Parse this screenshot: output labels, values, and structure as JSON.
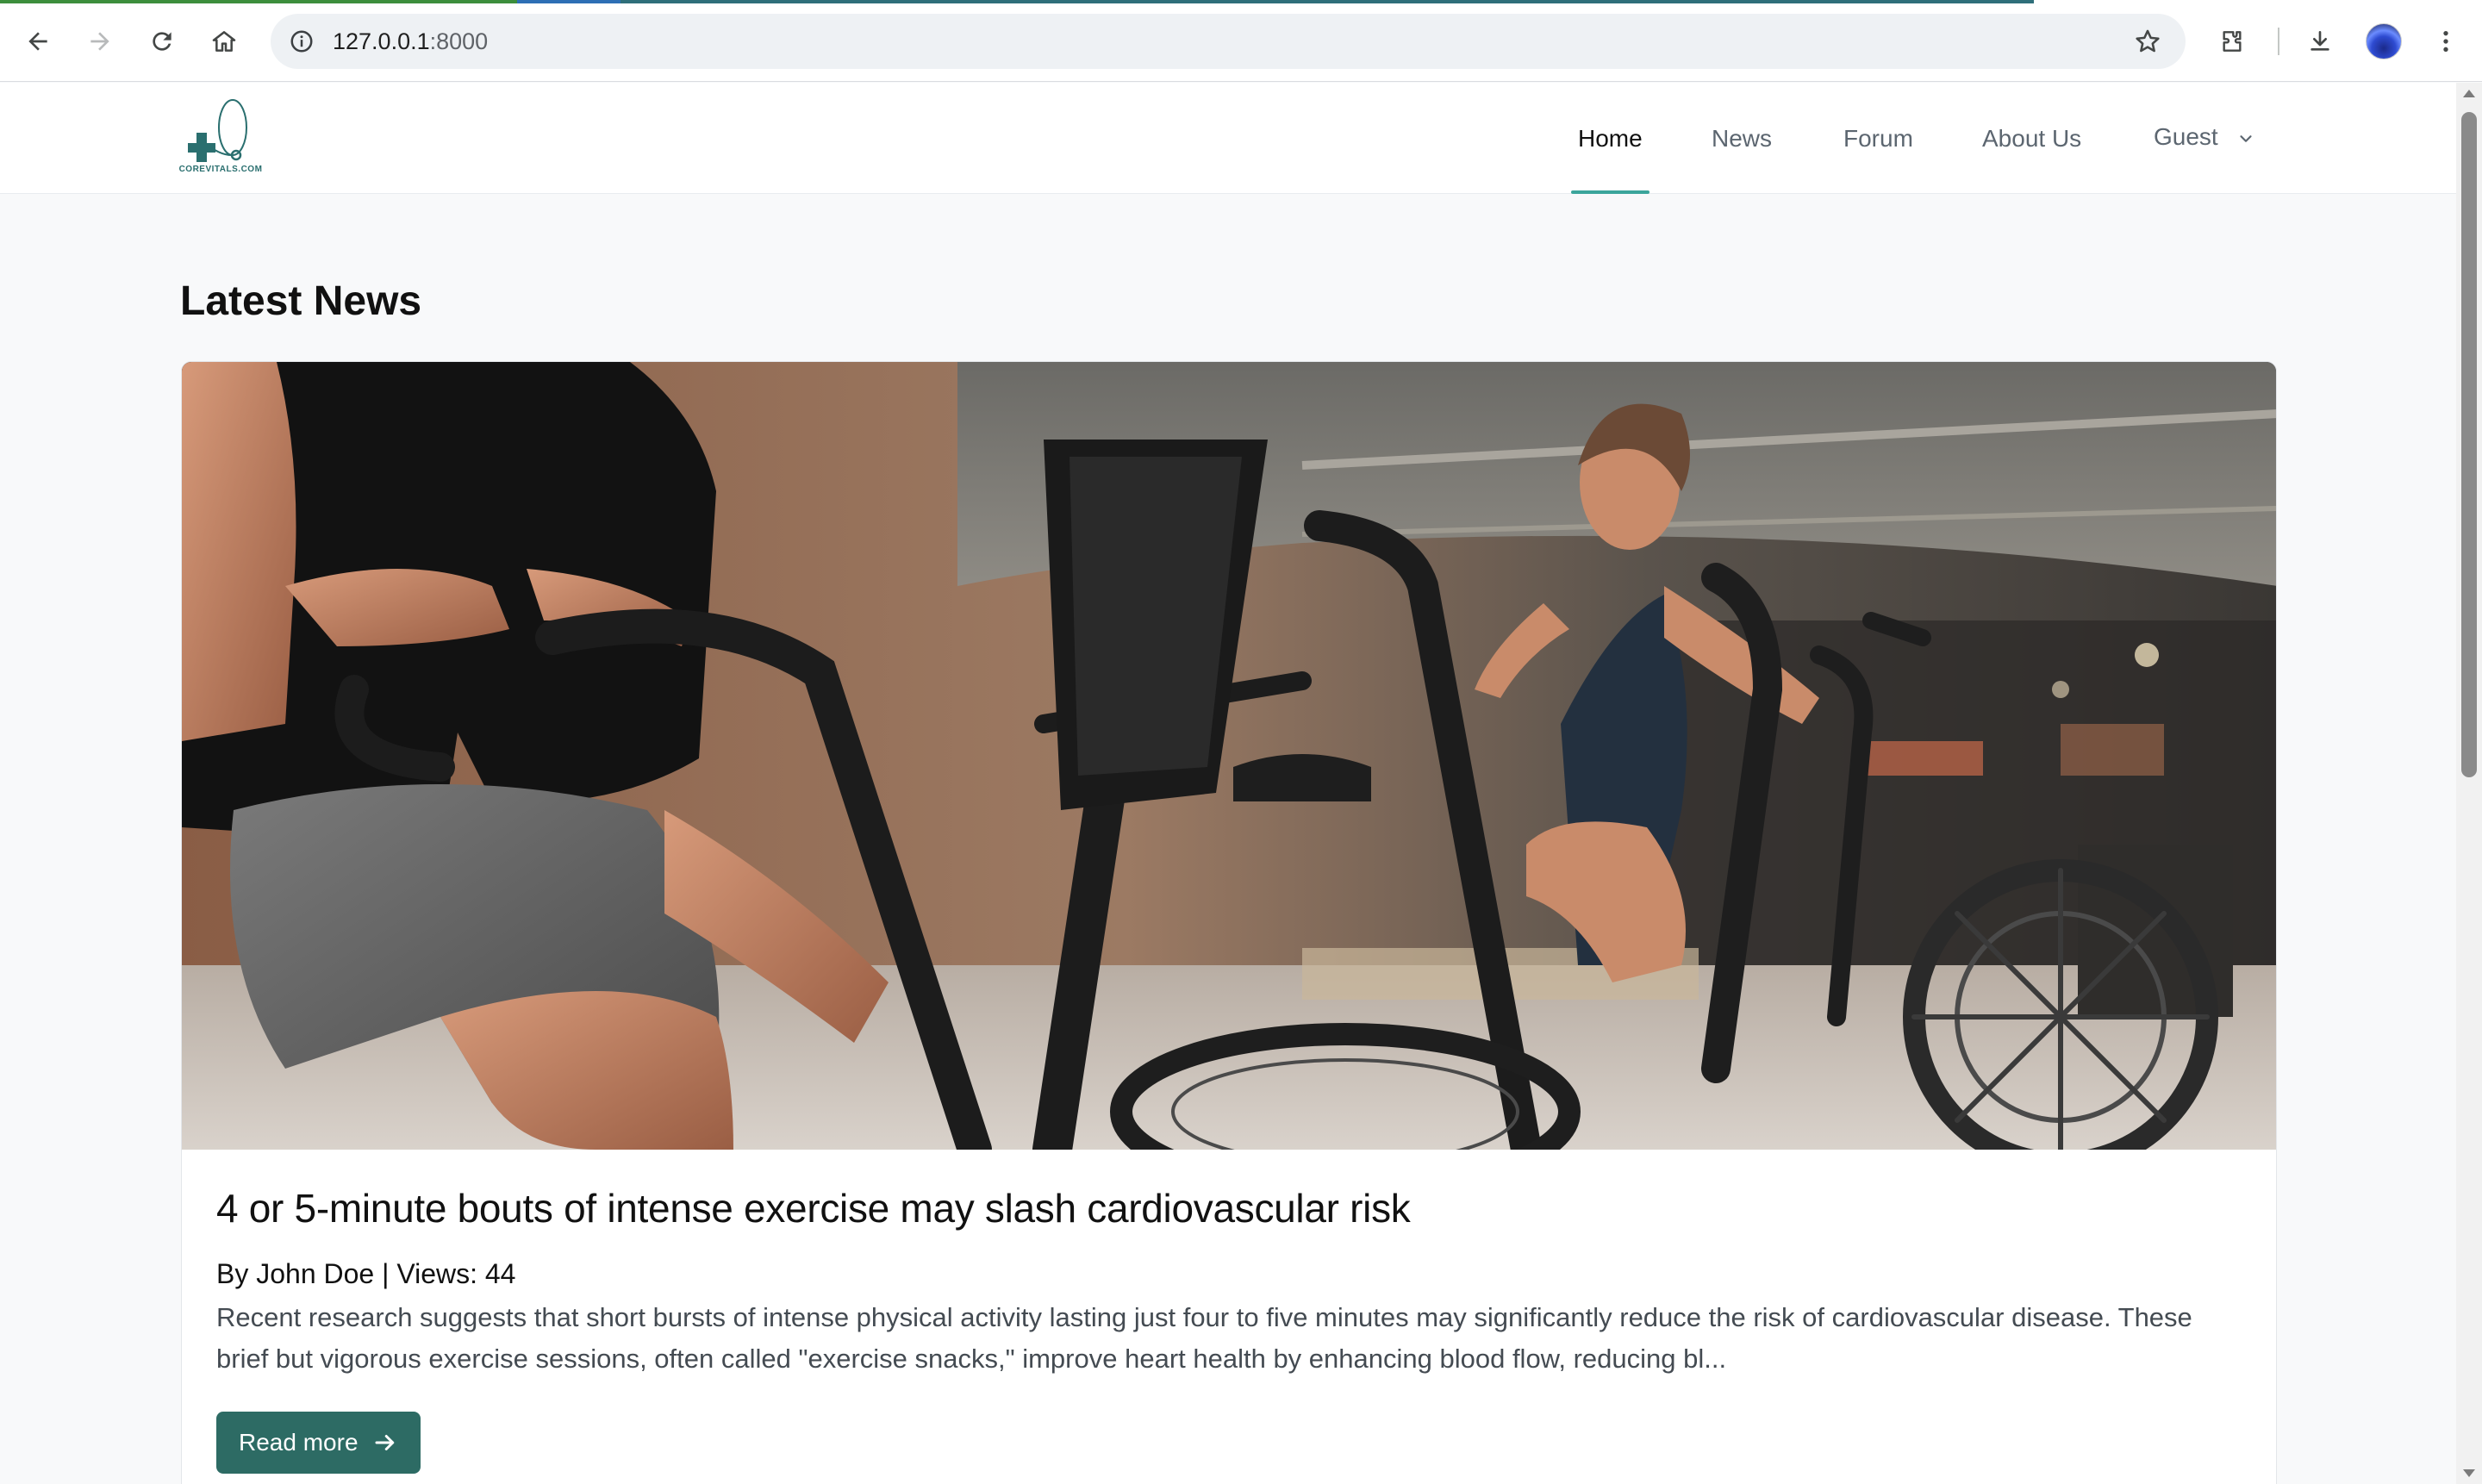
{
  "browser": {
    "url_host": "127.0.0.1",
    "url_port": ":8000",
    "icons": [
      "back-icon",
      "forward-icon",
      "reload-icon",
      "home-icon",
      "site-info-icon",
      "bookmark-star-icon",
      "extensions-icon",
      "download-icon",
      "profile-avatar",
      "menu-kebab-icon"
    ]
  },
  "site": {
    "logo_text": "COREVITALS.COM",
    "nav": [
      {
        "label": "Home",
        "active": true
      },
      {
        "label": "News",
        "active": false
      },
      {
        "label": "Forum",
        "active": false
      },
      {
        "label": "About Us",
        "active": false
      }
    ],
    "account_label": "Guest",
    "accent_color": "#3ba59b",
    "button_color": "#2d6b64"
  },
  "main": {
    "section_title": "Latest News",
    "article": {
      "title": "4 or 5-minute bouts of intense exercise may slash cardiovascular risk",
      "meta": "By John Doe | Views: 44",
      "excerpt": "Recent research suggests that short bursts of intense physical activity lasting just four to five minutes may significantly reduce the risk of cardiovascular disease. These brief but vigorous exercise sessions, often called \"exercise snacks,\" improve heart health by enhancing blood flow, reducing bl...",
      "read_more_label": "Read more",
      "image_description_icon": "hero-photo-exercise-bikes"
    }
  }
}
